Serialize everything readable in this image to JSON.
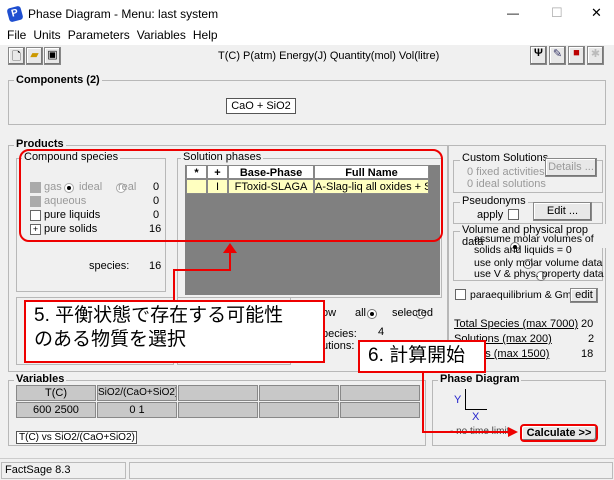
{
  "window": {
    "title": "Phase Diagram - Menu: last system",
    "minimize": "—",
    "maximize": "☐",
    "close": "✕"
  },
  "menu": [
    "File",
    "Units",
    "Parameters",
    "Variables",
    "Help"
  ],
  "toolbar": {
    "units": "T(C)  P(atm)  Energy(J)  Quantity(mol)  Vol(litre)"
  },
  "components": {
    "title": "Components  (2)",
    "value": "CaO  +  SiO2"
  },
  "products": {
    "title": "Products",
    "compound": {
      "title": "Compound species",
      "gas": "gas",
      "ideal": "ideal",
      "real": "real",
      "gas_count": "0",
      "aqueous": "aqueous",
      "aqueous_count": "0",
      "pure_liquids": "pure liquids",
      "pure_liquids_count": "0",
      "pure_solids": "pure solids",
      "pure_solids_count": "16",
      "pure_solids_mark": "+",
      "species_label": "species:",
      "species_count": "16"
    },
    "solution": {
      "title": "Solution phases",
      "headers": [
        "*",
        "+",
        "Base-Phase",
        "Full Name"
      ],
      "rows": [
        {
          "star": "",
          "plus": "I",
          "base": "FToxid-SLAGA",
          "full": "A-Slag-liq all oxides + S"
        }
      ],
      "show": "ow",
      "all": "all",
      "selected": "selected",
      "species_label": "pecies:",
      "species_count": "4",
      "solutions_label": "utions:"
    }
  },
  "right": {
    "custom_title": "Custom Solutions",
    "fixed": "0  fixed activities",
    "ideal": "0  ideal solutions",
    "details": "Details ...",
    "pseudo_title": "Pseudonyms",
    "apply": "apply",
    "edit": "Edit ...",
    "volume_title": "Volume and physical prop data",
    "vol_opt1": "assume molar volumes of solids and liquids = 0",
    "vol_opt2": "use only molar volume data",
    "vol_opt3": "use V & phys. property data",
    "para": "paraequilibrium & Gmin",
    "para_edit": "edit",
    "total_species": "Total Species (max 7000)",
    "total_species_val": "20",
    "solutions": "Solutions (max 200)",
    "solutions_val": "2",
    "phases": "Phases (max 1500)",
    "phases_val": "18"
  },
  "variables": {
    "title": "Variables",
    "headers": [
      "T(C)",
      "SiO2/(CaO+SiO2)",
      "",
      "",
      ""
    ],
    "values": [
      "600 2500",
      "0 1",
      "",
      "",
      ""
    ],
    "axis_label": "T(C)  vs  SiO2/(CaO+SiO2)"
  },
  "phase_diagram": {
    "title": "Phase Diagram",
    "y": "Y",
    "x": "X",
    "time": "- no time limit -",
    "calculate": "Calculate >>"
  },
  "annotations": {
    "step5_line1": "5. 平衡状態で存在する可能性",
    "step5_line2": "のある物質を選択",
    "step6": "6. 計算開始"
  },
  "status": {
    "version": "FactSage 8.3"
  },
  "colors": {
    "annotation": "#e00000",
    "selected_row": "#ffffc0",
    "grid_bg": "#808080"
  }
}
